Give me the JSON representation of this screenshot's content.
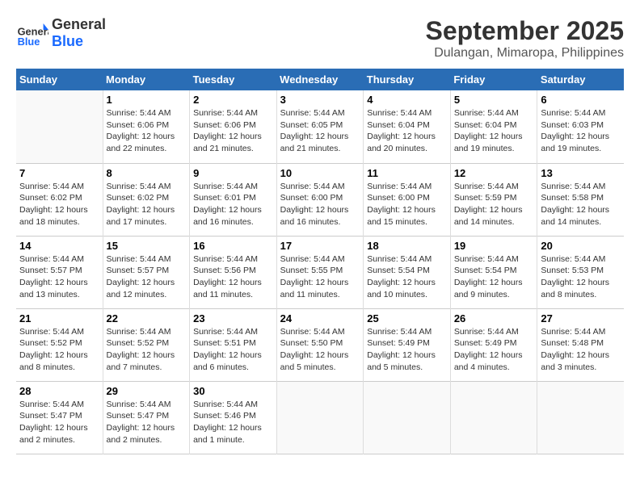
{
  "header": {
    "logo_general": "General",
    "logo_blue": "Blue",
    "title": "September 2025",
    "subtitle": "Dulangan, Mimaropa, Philippines"
  },
  "days_of_week": [
    "Sunday",
    "Monday",
    "Tuesday",
    "Wednesday",
    "Thursday",
    "Friday",
    "Saturday"
  ],
  "weeks": [
    [
      {
        "num": "",
        "info": ""
      },
      {
        "num": "1",
        "info": "Sunrise: 5:44 AM\nSunset: 6:06 PM\nDaylight: 12 hours\nand 22 minutes."
      },
      {
        "num": "2",
        "info": "Sunrise: 5:44 AM\nSunset: 6:06 PM\nDaylight: 12 hours\nand 21 minutes."
      },
      {
        "num": "3",
        "info": "Sunrise: 5:44 AM\nSunset: 6:05 PM\nDaylight: 12 hours\nand 21 minutes."
      },
      {
        "num": "4",
        "info": "Sunrise: 5:44 AM\nSunset: 6:04 PM\nDaylight: 12 hours\nand 20 minutes."
      },
      {
        "num": "5",
        "info": "Sunrise: 5:44 AM\nSunset: 6:04 PM\nDaylight: 12 hours\nand 19 minutes."
      },
      {
        "num": "6",
        "info": "Sunrise: 5:44 AM\nSunset: 6:03 PM\nDaylight: 12 hours\nand 19 minutes."
      }
    ],
    [
      {
        "num": "7",
        "info": "Sunrise: 5:44 AM\nSunset: 6:02 PM\nDaylight: 12 hours\nand 18 minutes."
      },
      {
        "num": "8",
        "info": "Sunrise: 5:44 AM\nSunset: 6:02 PM\nDaylight: 12 hours\nand 17 minutes."
      },
      {
        "num": "9",
        "info": "Sunrise: 5:44 AM\nSunset: 6:01 PM\nDaylight: 12 hours\nand 16 minutes."
      },
      {
        "num": "10",
        "info": "Sunrise: 5:44 AM\nSunset: 6:00 PM\nDaylight: 12 hours\nand 16 minutes."
      },
      {
        "num": "11",
        "info": "Sunrise: 5:44 AM\nSunset: 6:00 PM\nDaylight: 12 hours\nand 15 minutes."
      },
      {
        "num": "12",
        "info": "Sunrise: 5:44 AM\nSunset: 5:59 PM\nDaylight: 12 hours\nand 14 minutes."
      },
      {
        "num": "13",
        "info": "Sunrise: 5:44 AM\nSunset: 5:58 PM\nDaylight: 12 hours\nand 14 minutes."
      }
    ],
    [
      {
        "num": "14",
        "info": "Sunrise: 5:44 AM\nSunset: 5:57 PM\nDaylight: 12 hours\nand 13 minutes."
      },
      {
        "num": "15",
        "info": "Sunrise: 5:44 AM\nSunset: 5:57 PM\nDaylight: 12 hours\nand 12 minutes."
      },
      {
        "num": "16",
        "info": "Sunrise: 5:44 AM\nSunset: 5:56 PM\nDaylight: 12 hours\nand 11 minutes."
      },
      {
        "num": "17",
        "info": "Sunrise: 5:44 AM\nSunset: 5:55 PM\nDaylight: 12 hours\nand 11 minutes."
      },
      {
        "num": "18",
        "info": "Sunrise: 5:44 AM\nSunset: 5:54 PM\nDaylight: 12 hours\nand 10 minutes."
      },
      {
        "num": "19",
        "info": "Sunrise: 5:44 AM\nSunset: 5:54 PM\nDaylight: 12 hours\nand 9 minutes."
      },
      {
        "num": "20",
        "info": "Sunrise: 5:44 AM\nSunset: 5:53 PM\nDaylight: 12 hours\nand 8 minutes."
      }
    ],
    [
      {
        "num": "21",
        "info": "Sunrise: 5:44 AM\nSunset: 5:52 PM\nDaylight: 12 hours\nand 8 minutes."
      },
      {
        "num": "22",
        "info": "Sunrise: 5:44 AM\nSunset: 5:52 PM\nDaylight: 12 hours\nand 7 minutes."
      },
      {
        "num": "23",
        "info": "Sunrise: 5:44 AM\nSunset: 5:51 PM\nDaylight: 12 hours\nand 6 minutes."
      },
      {
        "num": "24",
        "info": "Sunrise: 5:44 AM\nSunset: 5:50 PM\nDaylight: 12 hours\nand 5 minutes."
      },
      {
        "num": "25",
        "info": "Sunrise: 5:44 AM\nSunset: 5:49 PM\nDaylight: 12 hours\nand 5 minutes."
      },
      {
        "num": "26",
        "info": "Sunrise: 5:44 AM\nSunset: 5:49 PM\nDaylight: 12 hours\nand 4 minutes."
      },
      {
        "num": "27",
        "info": "Sunrise: 5:44 AM\nSunset: 5:48 PM\nDaylight: 12 hours\nand 3 minutes."
      }
    ],
    [
      {
        "num": "28",
        "info": "Sunrise: 5:44 AM\nSunset: 5:47 PM\nDaylight: 12 hours\nand 2 minutes."
      },
      {
        "num": "29",
        "info": "Sunrise: 5:44 AM\nSunset: 5:47 PM\nDaylight: 12 hours\nand 2 minutes."
      },
      {
        "num": "30",
        "info": "Sunrise: 5:44 AM\nSunset: 5:46 PM\nDaylight: 12 hours\nand 1 minute."
      },
      {
        "num": "",
        "info": ""
      },
      {
        "num": "",
        "info": ""
      },
      {
        "num": "",
        "info": ""
      },
      {
        "num": "",
        "info": ""
      }
    ]
  ]
}
